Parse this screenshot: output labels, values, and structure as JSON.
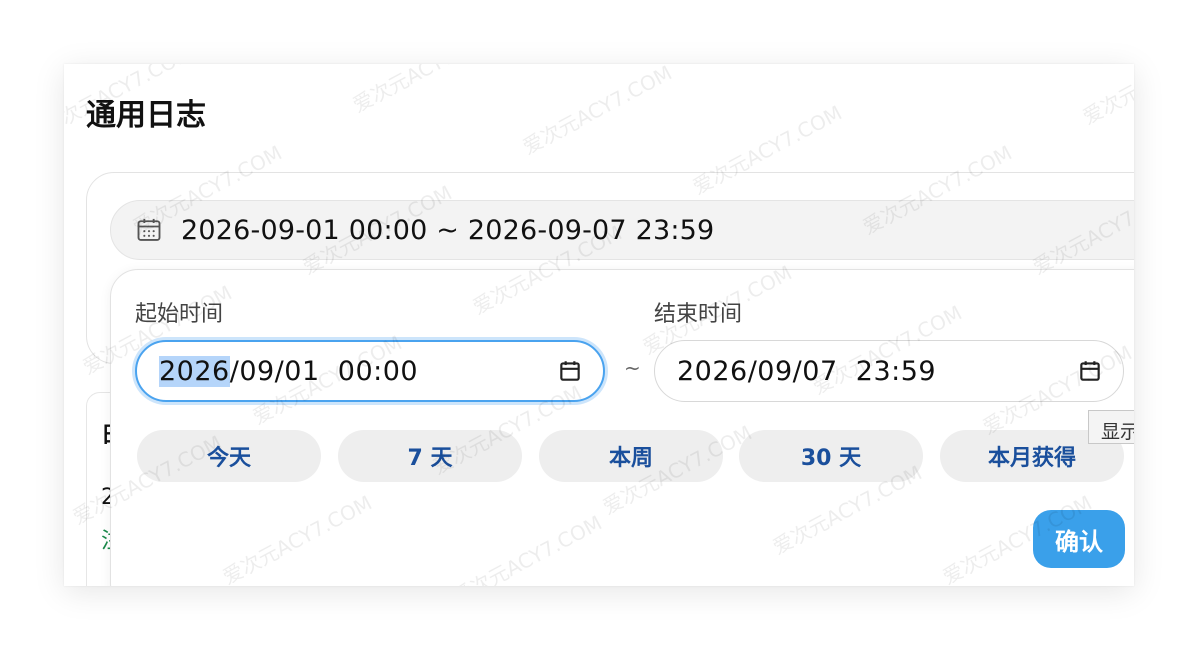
{
  "page": {
    "title": "通用日志"
  },
  "range": {
    "display": "2026-09-01 00:00 ~ 2026-09-07 23:59"
  },
  "start": {
    "label": "起始时间",
    "value_selected": "2026",
    "value_rest": "/09/01  00:00"
  },
  "end": {
    "label": "结束时间",
    "value": "2026/09/07  23:59"
  },
  "separator": "~",
  "quick": [
    "今天",
    "7 天",
    "本周",
    "30 天",
    "本月获得"
  ],
  "confirm_label": "确认",
  "tooltip": "显示",
  "background_chars": [
    "日",
    "2",
    "注"
  ],
  "watermark": "爱次元ACY7.COM",
  "colors": {
    "accent": "#3aa0ea",
    "quick_text": "#1a4f9c",
    "selection": "#b5d5fa"
  }
}
